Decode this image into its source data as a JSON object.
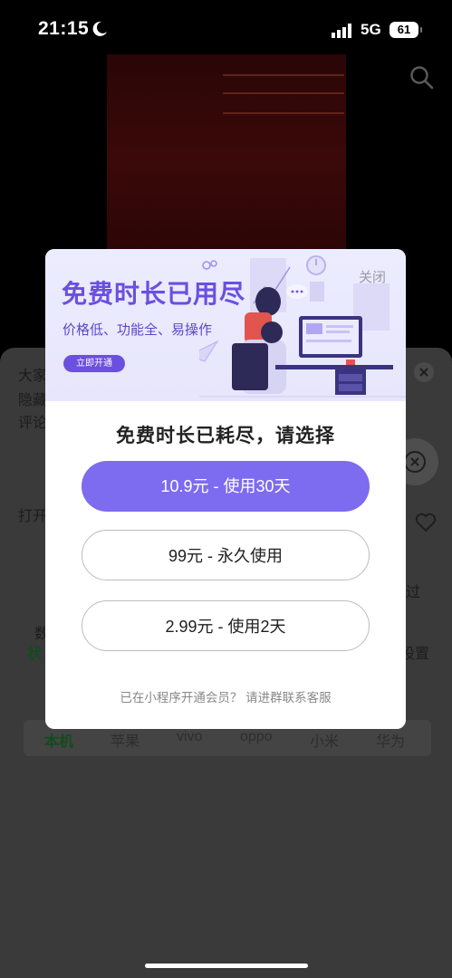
{
  "status_bar": {
    "time": "21:15",
    "network": "5G",
    "battery": "61"
  },
  "background": {
    "partial_texts": {
      "line1": "大家",
      "line2": "隐藏",
      "line3": "评论",
      "line4": "打开",
      "right_text": "过",
      "left_label": "数",
      "left_label2": "状",
      "right_label": "设置"
    },
    "tabs": [
      {
        "label": "本机",
        "active": true
      },
      {
        "label": "苹果",
        "active": false
      },
      {
        "label": "vivo",
        "active": false
      },
      {
        "label": "oppo",
        "active": false
      },
      {
        "label": "小米",
        "active": false
      },
      {
        "label": "华为",
        "active": false
      }
    ]
  },
  "modal": {
    "banner": {
      "title": "免费时长已用尽",
      "subtitle": "价格低、功能全、易操作",
      "cta": "立即开通"
    },
    "close_label": "关闭",
    "title": "免费时长已耗尽，请选择",
    "options": [
      {
        "label": "10.9元 - 使用30天",
        "style": "primary"
      },
      {
        "label": "99元 - 永久使用",
        "style": "outline"
      },
      {
        "label": "2.99元 - 使用2天",
        "style": "outline"
      }
    ],
    "footer": "已在小程序开通会员？ 请进群联系客服"
  },
  "colors": {
    "accent": "#7d6bf0",
    "banner_title": "#6a4fe0",
    "banner_bg": "#e9e8fc"
  }
}
